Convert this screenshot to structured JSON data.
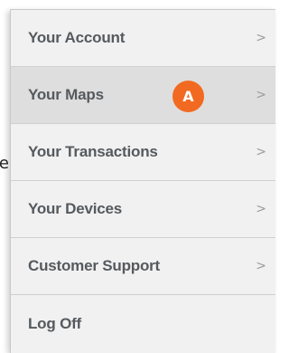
{
  "stray_text": "e",
  "menu": {
    "items": [
      {
        "label": "Your Account",
        "chevron": ">"
      },
      {
        "label": "Your Maps",
        "chevron": ">",
        "badge": "A"
      },
      {
        "label": "Your Transactions",
        "chevron": ">"
      },
      {
        "label": "Your Devices",
        "chevron": ">"
      },
      {
        "label": "Customer Support",
        "chevron": ">"
      },
      {
        "label": "Log Off"
      }
    ]
  },
  "colors": {
    "badge": "#f26a21",
    "active_row": "#dedede",
    "menu_background": "#f1f1f1",
    "label_text": "#555a5e"
  }
}
